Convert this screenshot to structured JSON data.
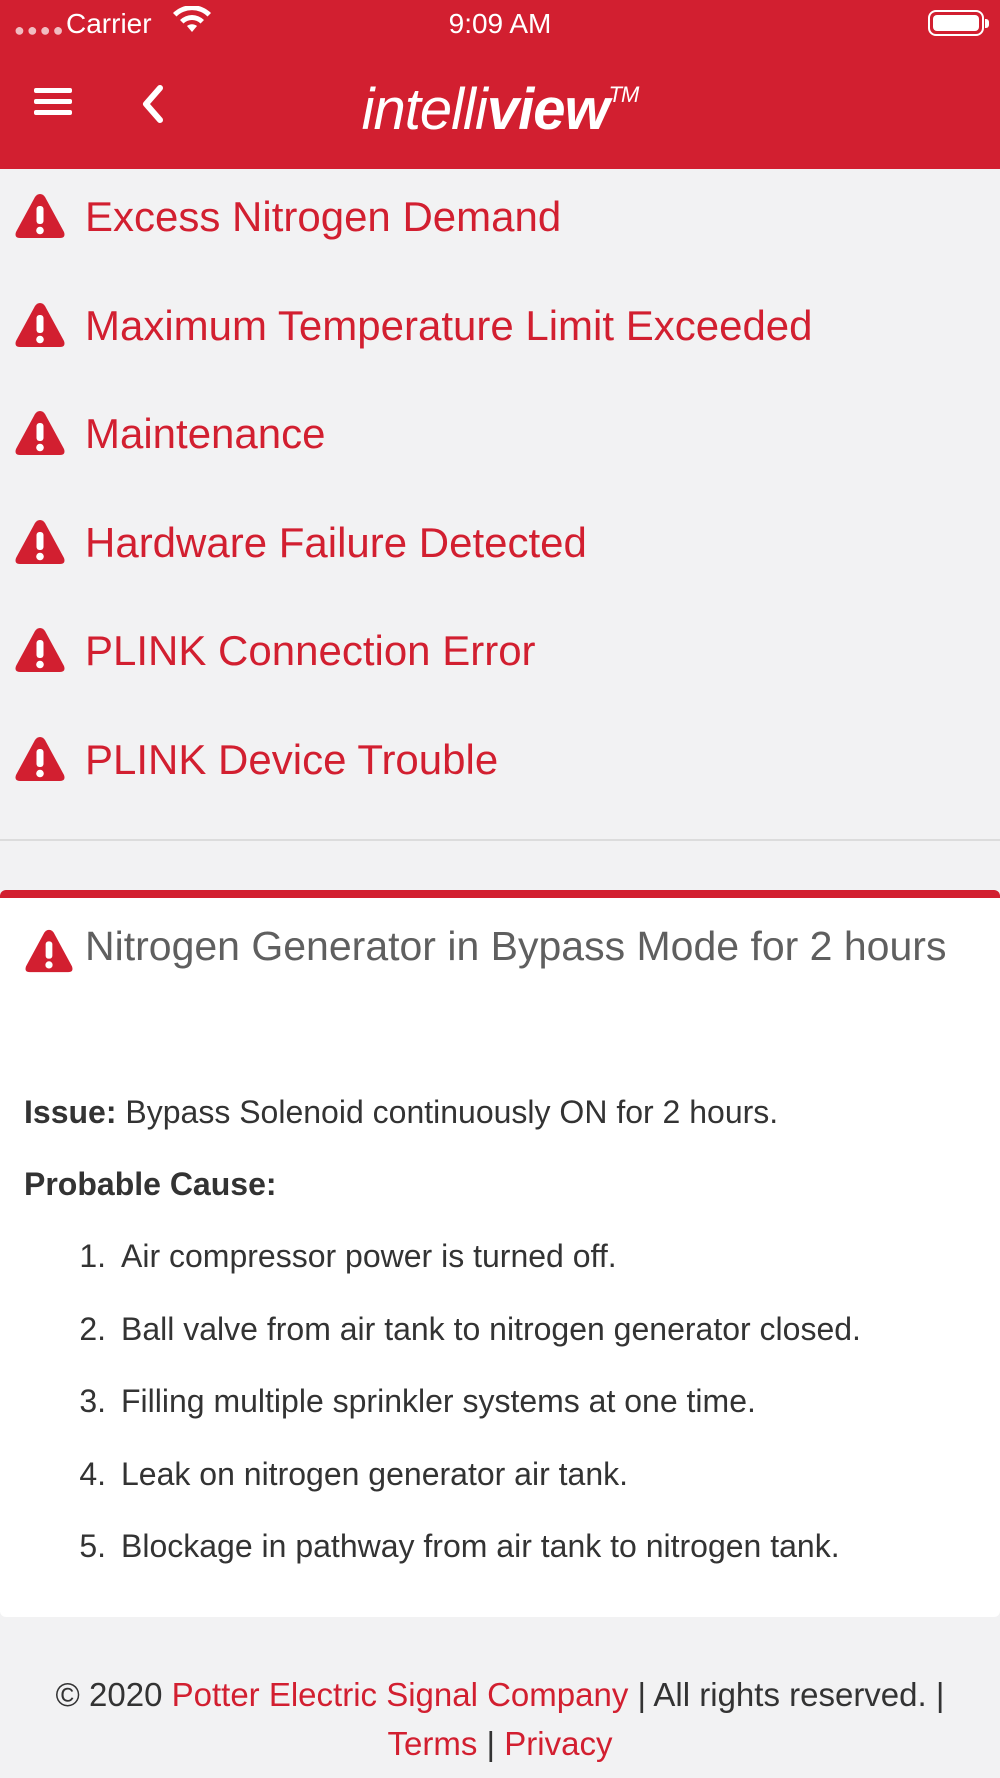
{
  "status_bar": {
    "carrier": "Carrier",
    "time": "9:09 AM",
    "signal_icon": "signal-dots-icon",
    "wifi_icon": "wifi-icon",
    "battery_icon": "battery-full-icon"
  },
  "header": {
    "logo_light": "intelli",
    "logo_bold": "view",
    "logo_tm": "TM",
    "menu_icon": "hamburger-menu-icon",
    "back_icon": "chevron-left-icon",
    "background_color": "#d21f30"
  },
  "alerts": [
    {
      "label": "Excess Nitrogen Demand",
      "icon": "warning-triangle-icon"
    },
    {
      "label": "Maximum Temperature Limit Exceeded",
      "icon": "warning-triangle-icon"
    },
    {
      "label": "Maintenance",
      "icon": "warning-triangle-icon"
    },
    {
      "label": "Hardware Failure Detected",
      "icon": "warning-triangle-icon"
    },
    {
      "label": "PLINK Connection Error",
      "icon": "warning-triangle-icon"
    },
    {
      "label": "PLINK Device Trouble",
      "icon": "warning-triangle-icon"
    }
  ],
  "detail": {
    "title": "Nitrogen Generator in Bypass Mode for 2 hours",
    "issue_label": "Issue:",
    "issue_text": "Bypass Solenoid continuously ON for 2 hours.",
    "cause_label": "Probable Cause:",
    "causes": [
      {
        "num": "1.",
        "text": "Air compressor power is turned off."
      },
      {
        "num": "2.",
        "text": "Ball valve from air tank to nitrogen generator closed."
      },
      {
        "num": "3.",
        "text": "Filling multiple sprinkler systems at one time."
      },
      {
        "num": "4.",
        "text": "Leak on nitrogen generator air tank."
      },
      {
        "num": "5.",
        "text": "Blockage in pathway from air tank to nitrogen tank."
      }
    ]
  },
  "footer": {
    "copyright": "© 2020",
    "company": "Potter Electric Signal Company",
    "rights": "| All rights reserved. |",
    "terms": "Terms",
    "separator": "|",
    "privacy": "Privacy"
  },
  "colors": {
    "accent": "#d21f30",
    "page_background": "#f2f2f3",
    "card_background": "#ffffff"
  }
}
